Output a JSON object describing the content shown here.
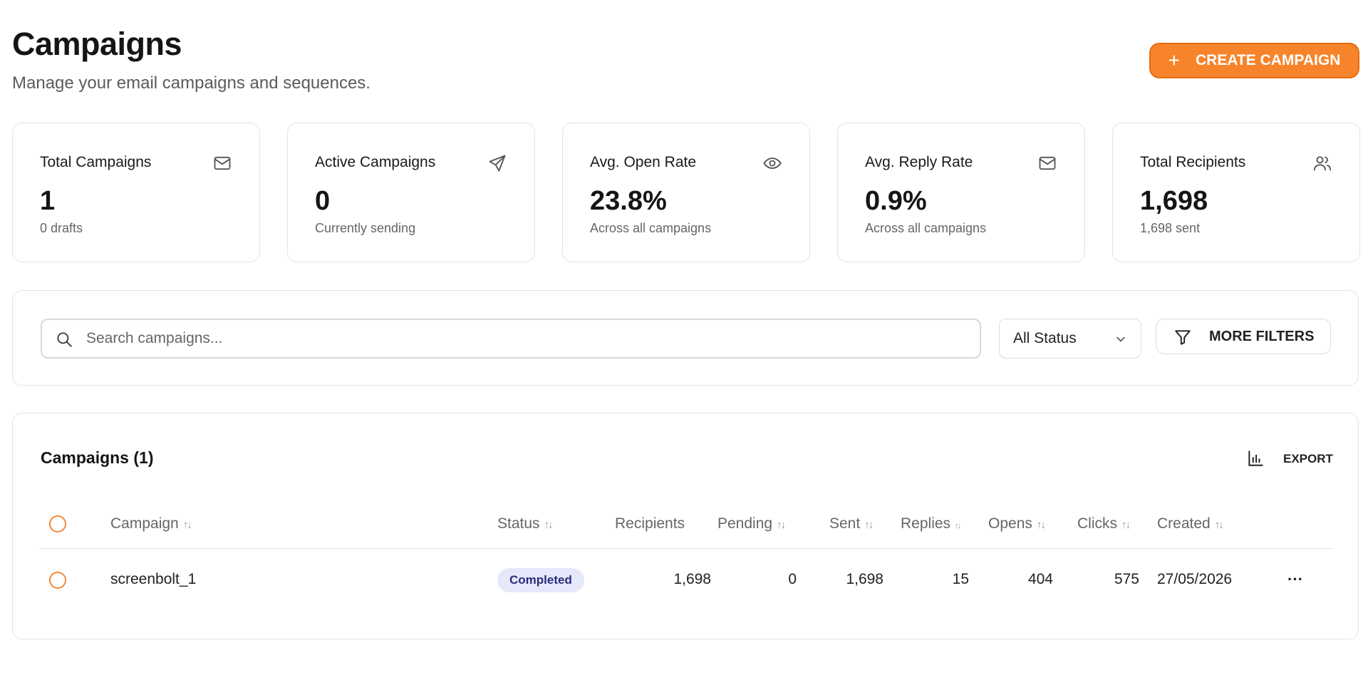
{
  "header": {
    "title": "Campaigns",
    "subtitle": "Manage your email campaigns and sequences.",
    "create_button": {
      "icon": "plus-icon",
      "label": "CREATE CAMPAIGN"
    }
  },
  "stats": [
    {
      "label": "Total Campaigns",
      "value": "1",
      "sub": "0 drafts",
      "icon": "mail-icon"
    },
    {
      "label": "Active Campaigns",
      "value": "0",
      "sub": "Currently sending",
      "icon": "send-icon"
    },
    {
      "label": "Avg. Open Rate",
      "value": "23.8%",
      "sub": "Across all campaigns",
      "icon": "eye-icon"
    },
    {
      "label": "Avg. Reply Rate",
      "value": "0.9%",
      "sub": "Across all campaigns",
      "icon": "mail-icon"
    },
    {
      "label": "Total Recipients",
      "value": "1,698",
      "sub": "1,698 sent",
      "icon": "users-icon"
    }
  ],
  "filters": {
    "search_placeholder": "Search campaigns...",
    "status_value": "All Status",
    "more_filters_label": "MORE FILTERS"
  },
  "table": {
    "title": "Campaigns (1)",
    "export_label": "EXPORT",
    "columns": {
      "campaign": "Campaign",
      "status": "Status",
      "recipients": "Recipients",
      "pending": "Pending",
      "sent": "Sent",
      "replies": "Replies",
      "opens": "Opens",
      "clicks": "Clicks",
      "created": "Created"
    },
    "sort_glyph": "↑↓",
    "rows": [
      {
        "campaign": "screenbolt_1",
        "status": "Completed",
        "recipients": "1,698",
        "pending": "0",
        "sent": "1,698",
        "replies": "15",
        "opens": "404",
        "clicks": "575",
        "created": "27/05/2026",
        "menu": "···"
      }
    ]
  },
  "colors": {
    "accent": "#f7842b",
    "badge_bg": "#e5e7fb",
    "badge_text": "#2a2f7a"
  }
}
